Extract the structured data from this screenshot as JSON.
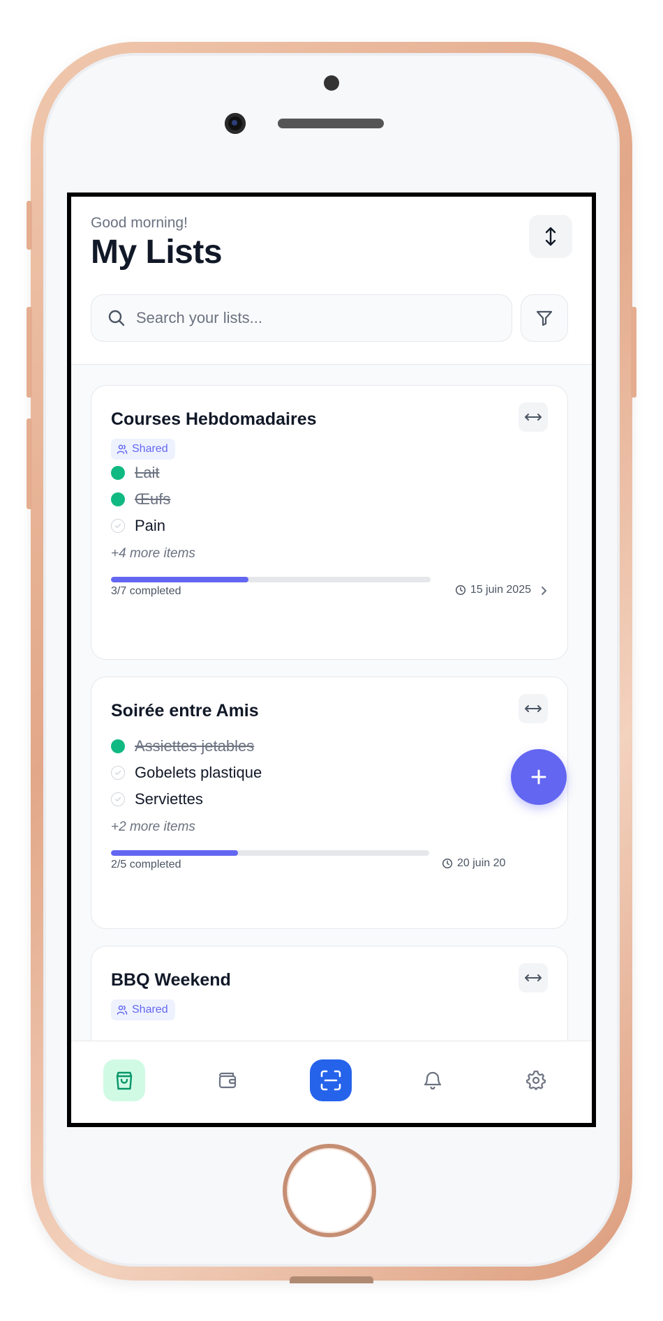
{
  "header": {
    "greeting": "Good morning!",
    "title": "My Lists",
    "search_placeholder": "Search your lists..."
  },
  "lists": [
    {
      "title": "Courses Hebdomadaires",
      "shared_label": "Shared",
      "items": [
        {
          "label": "Lait",
          "done": true
        },
        {
          "label": "Œufs",
          "done": true
        },
        {
          "label": "Pain",
          "done": false
        }
      ],
      "more": "+4 more items",
      "completed": "3/7 completed",
      "progress": 0.43,
      "date": "15 juin 2025"
    },
    {
      "title": "Soirée entre Amis",
      "items": [
        {
          "label": "Assiettes jetables",
          "done": true
        },
        {
          "label": "Gobelets plastique",
          "done": false
        },
        {
          "label": "Serviettes",
          "done": false
        }
      ],
      "more": "+2 more items",
      "completed": "2/5 completed",
      "progress": 0.4,
      "date": "20 juin 20"
    },
    {
      "title": "BBQ Weekend",
      "shared_label": "Shared"
    }
  ],
  "colors": {
    "accent": "#6366f1",
    "done": "#10b981",
    "nav_active_bg": "#d1fae5",
    "nav_active_icon": "#059669",
    "scan_bg": "#2563eb"
  },
  "nav": {
    "items": [
      "shopping-bag-icon",
      "wallet-icon",
      "scan-icon",
      "bell-icon",
      "settings-icon"
    ],
    "active": "shopping-bag-icon"
  }
}
